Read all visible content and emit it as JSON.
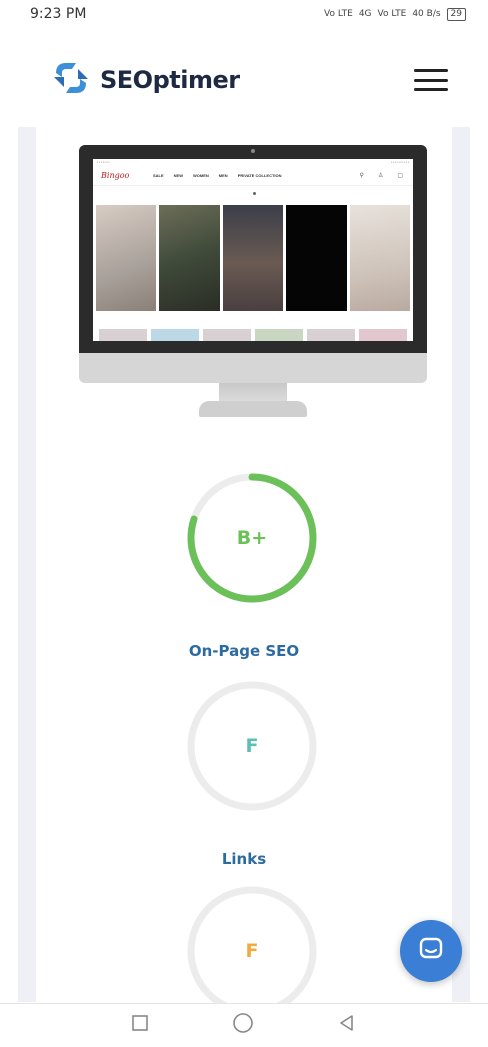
{
  "status_bar": {
    "time": "9:23 PM",
    "network_1": "Vo LTE",
    "network_2": "4G",
    "network_3": "Vo LTE",
    "speed": "40 B/s",
    "battery": "29"
  },
  "header": {
    "brand": "SEOptimer",
    "logo_color": "#3d8fd9",
    "menu_icon": "hamburger-icon"
  },
  "preview_site": {
    "logo": "Bingoo",
    "menu": [
      "SALE",
      "NEW",
      "WOMEN",
      "MEN",
      "PRIVATE COLLECTION"
    ]
  },
  "scores": [
    {
      "grade": "B+",
      "label": "",
      "progress": 0.8,
      "color": "#6cc05a"
    },
    {
      "grade": "F",
      "label": "On-Page SEO",
      "progress": 0,
      "color": "#5bbfb3"
    },
    {
      "grade": "F",
      "label": "Links",
      "progress": 0,
      "color": "#f0ab3c"
    }
  ],
  "labels": {
    "onpage": "On-Page SEO",
    "links": "Links"
  },
  "chat": {
    "icon": "chat-bubble-icon"
  },
  "nav": {
    "icons": [
      "recent-apps-icon",
      "home-icon",
      "back-icon"
    ]
  }
}
